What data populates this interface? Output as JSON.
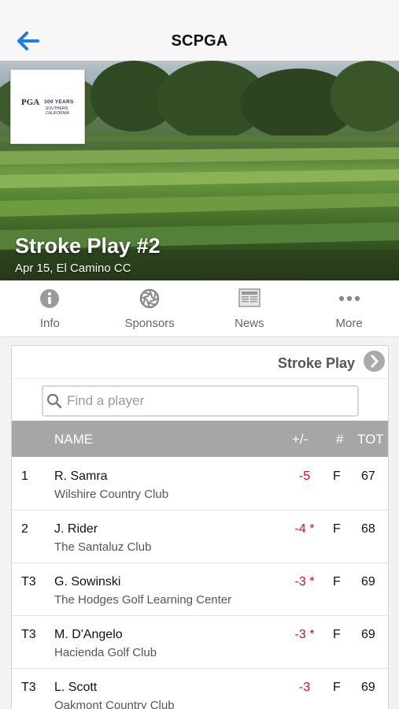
{
  "nav": {
    "title": "SCPGA",
    "back_icon": "back-arrow-icon",
    "accent": "#1a7fe0"
  },
  "hero": {
    "title": "Stroke Play #2",
    "subtitle": "Apr 15, El Camino CC",
    "logo": {
      "mark": "PGA",
      "years": "100 YEARS",
      "region_line1": "SOUTHERN",
      "region_line2": "CALIFORNIA"
    }
  },
  "tabs": [
    {
      "label": "Info",
      "icon": "info-icon"
    },
    {
      "label": "Sponsors",
      "icon": "aperture-icon"
    },
    {
      "label": "News",
      "icon": "newspaper-icon"
    },
    {
      "label": "More",
      "icon": "more-dots-icon"
    }
  ],
  "round": {
    "label": "Stroke Play",
    "icon": "chevron-right-icon"
  },
  "search": {
    "placeholder": "Find a player",
    "value": ""
  },
  "table": {
    "headers": {
      "name": "NAME",
      "topar": "+/-",
      "thru": "#",
      "total": "TOT"
    },
    "rows": [
      {
        "pos": "1",
        "name": "R. Samra",
        "club": "Wilshire Country Club",
        "topar": "-5",
        "thru": "F",
        "total": "67"
      },
      {
        "pos": "2",
        "name": "J. Rider",
        "club": "The Santaluz Club",
        "topar": "-4 *",
        "thru": "F",
        "total": "68"
      },
      {
        "pos": "T3",
        "name": "G. Sowinski",
        "club": "The Hodges Golf Learning Center",
        "topar": "-3 *",
        "thru": "F",
        "total": "69"
      },
      {
        "pos": "T3",
        "name": "M. D'Angelo",
        "club": "Hacienda Golf Club",
        "topar": "-3 *",
        "thru": "F",
        "total": "69"
      },
      {
        "pos": "T3",
        "name": "L. Scott",
        "club": "Oakmont Country Club",
        "topar": "-3",
        "thru": "F",
        "total": "69"
      }
    ]
  },
  "colors": {
    "under_par": "#d0141b",
    "header_bg": "#a6a6a6"
  }
}
